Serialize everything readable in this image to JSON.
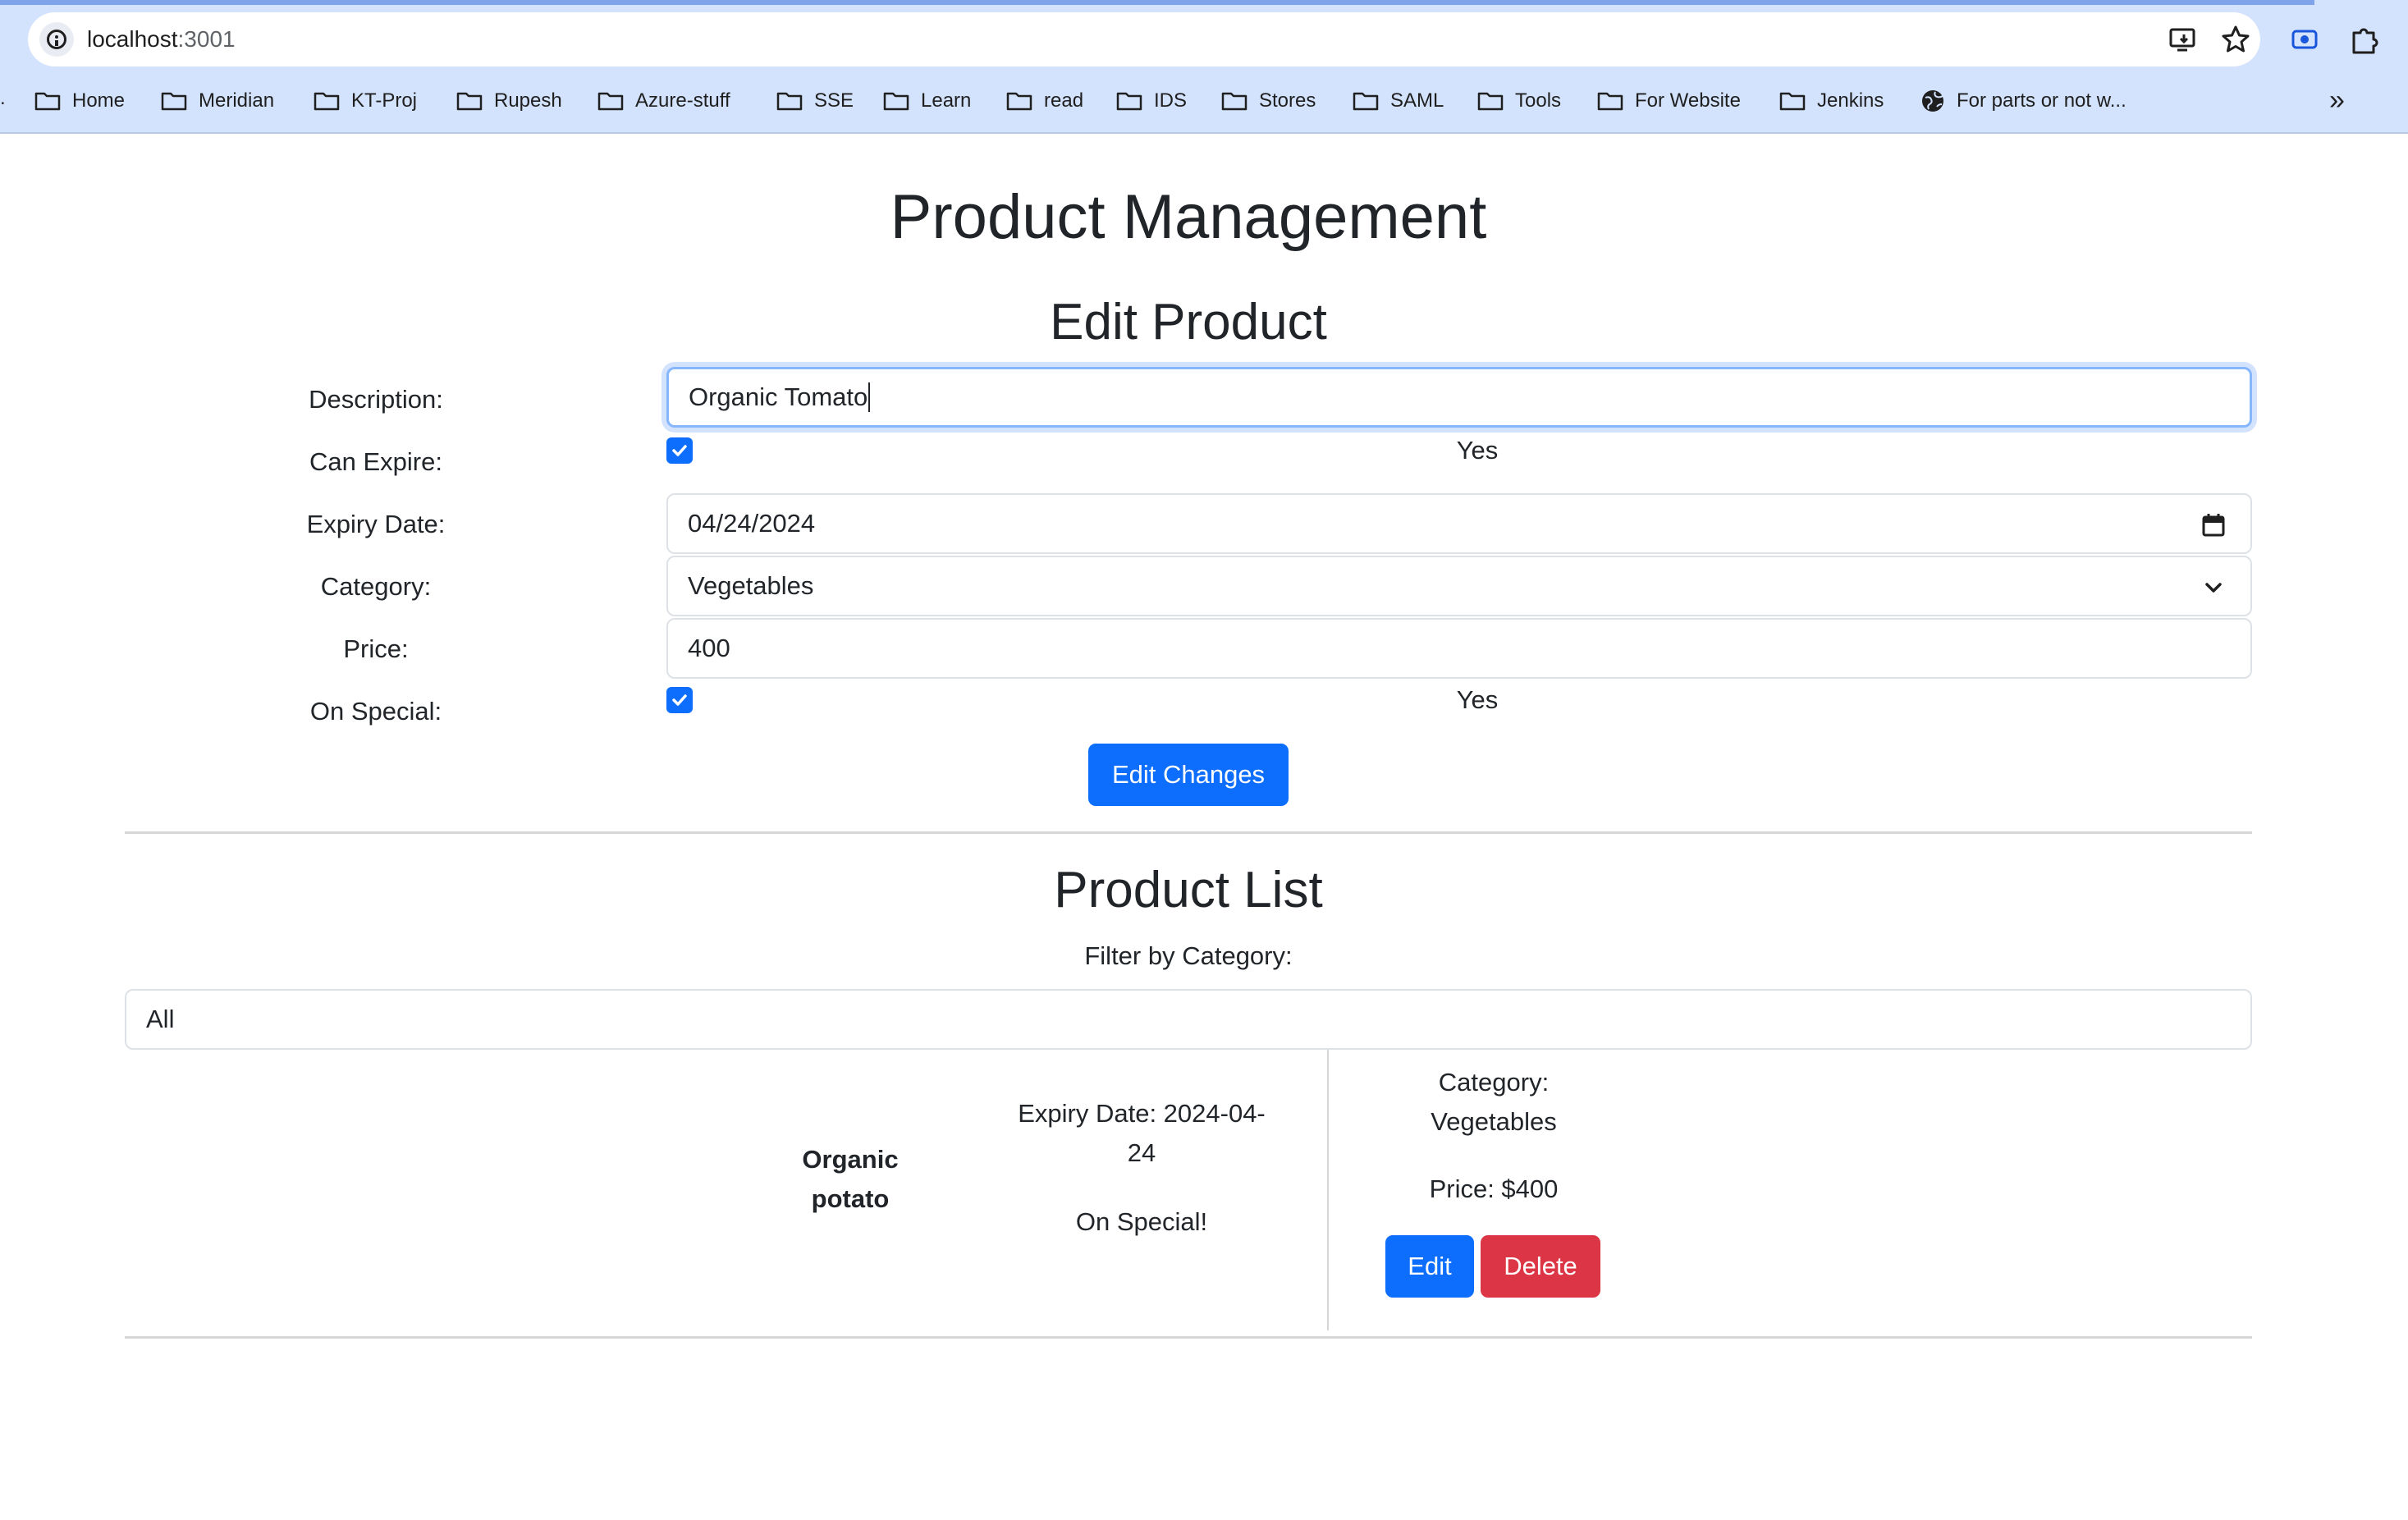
{
  "browser": {
    "url_host": "localhost",
    "url_port": ":3001",
    "bookmarks": [
      "Home",
      "Meridian",
      "KT-Proj",
      "Rupesh",
      "Azure-stuff",
      "SSE",
      "Learn",
      "read",
      "IDS",
      "Stores",
      "SAML",
      "Tools",
      "For Website",
      "Jenkins"
    ],
    "bookmark_site": "For parts or not w...",
    "more_label": "»",
    "leading_dot": "."
  },
  "page": {
    "title": "Product Management",
    "edit_form": {
      "heading": "Edit Product",
      "description_label": "Description:",
      "description_value": "Organic Tomato",
      "can_expire_label": "Can Expire:",
      "can_expire_checked": true,
      "can_expire_yes": "Yes",
      "expiry_label": "Expiry Date:",
      "expiry_value": "04/24/2024",
      "category_label": "Category:",
      "category_value": "Vegetables",
      "price_label": "Price:",
      "price_value": "400",
      "on_special_label": "On Special:",
      "on_special_checked": true,
      "on_special_yes": "Yes",
      "submit_label": "Edit Changes"
    },
    "list": {
      "heading": "Product List",
      "filter_label": "Filter by Category:",
      "filter_value": "All",
      "items": [
        {
          "name_line1": "Organic",
          "name_line2": "potato",
          "expiry_line1": "Expiry Date: 2024-04-",
          "expiry_line2": "24",
          "special": "On Special!",
          "category_line1": "Category:",
          "category_line2": "Vegetables",
          "price": "Price: $400",
          "edit_label": "Edit",
          "delete_label": "Delete"
        }
      ]
    }
  },
  "colors": {
    "primary": "#0d6efd",
    "danger": "#dc3545",
    "chrome": "#d3e3fd"
  }
}
